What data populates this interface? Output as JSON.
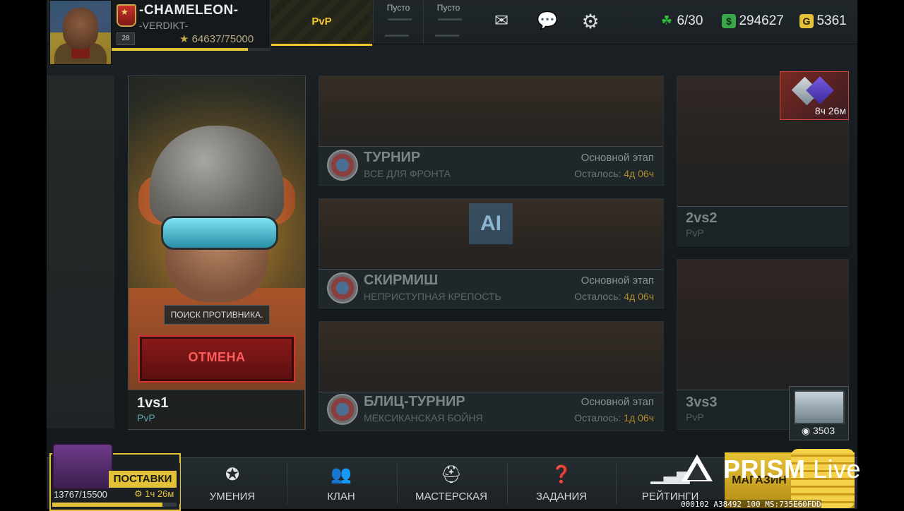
{
  "player": {
    "nickname": "-CHAMELEON-",
    "clan": "-VERDIKT-",
    "level": "28",
    "xp": "64637/75000",
    "xp_fraction": 0.862
  },
  "top_tabs": {
    "pvp_label": "PvP",
    "slots": [
      {
        "label": "Пусто"
      },
      {
        "label": "Пусто"
      }
    ]
  },
  "top_icons": [
    "mail-icon",
    "chat-icon",
    "gear-icon"
  ],
  "resources": {
    "energy": "6/30",
    "money": "294627",
    "gold": "5361",
    "colors": {
      "energy": "#2fbf3a",
      "money": "#3aa84a",
      "gold": "#e3c23a"
    }
  },
  "main_mode": {
    "search_status": "ПОИСК ПРОТИВНИКА.",
    "cancel_label": "ОТМЕНА",
    "title": "1vs1",
    "subtitle": "PvP"
  },
  "tournaments": [
    {
      "title": "ТУРНИР",
      "subtitle": "ВСЕ ДЛЯ ФРОНТА",
      "stage": "Основной этап",
      "left_prefix": "Осталось: ",
      "left_value": "4д 06ч"
    },
    {
      "title": "СКИРМИШ",
      "subtitle": "НЕПРИСТУПНАЯ КРЕПОСТЬ",
      "stage": "Основной этап",
      "left_prefix": "Осталось: ",
      "left_value": "4д 06ч"
    },
    {
      "title": "БЛИЦ-ТУРНИР",
      "subtitle": "МЕКСИКАНСКАЯ БОЙНЯ",
      "stage": "Основной этап",
      "left_prefix": "Осталось: ",
      "left_value": "1д 06ч"
    }
  ],
  "ai_badge": "AI",
  "side_modes": [
    {
      "title": "2vs2",
      "subtitle": "PvP"
    },
    {
      "title": "3vs3",
      "subtitle": "PvP"
    }
  ],
  "event_timer": "8ч 26м",
  "chest_value": "3503",
  "supply": {
    "label": "ПОСТАВКИ",
    "timer": "1ч 26м",
    "progress": "13767/15500",
    "progress_fraction": 0.888
  },
  "bottom_nav": [
    {
      "label": "УМЕНИЯ",
      "icon": "star-badge-icon"
    },
    {
      "label": "КЛАН",
      "icon": "people-icon"
    },
    {
      "label": "МАСТЕРСКАЯ",
      "icon": "helmet-icon"
    },
    {
      "label": "ЗАДАНИЯ",
      "icon": "question-icon"
    },
    {
      "label": "РЕЙТИНГИ",
      "icon": "bars-icon"
    }
  ],
  "shop_label": "МАГАЗИН",
  "overlay": {
    "brand": "PRISM",
    "brand_suffix": "Live",
    "debug": "000102 A38492 100 MS:735E60FDD"
  }
}
